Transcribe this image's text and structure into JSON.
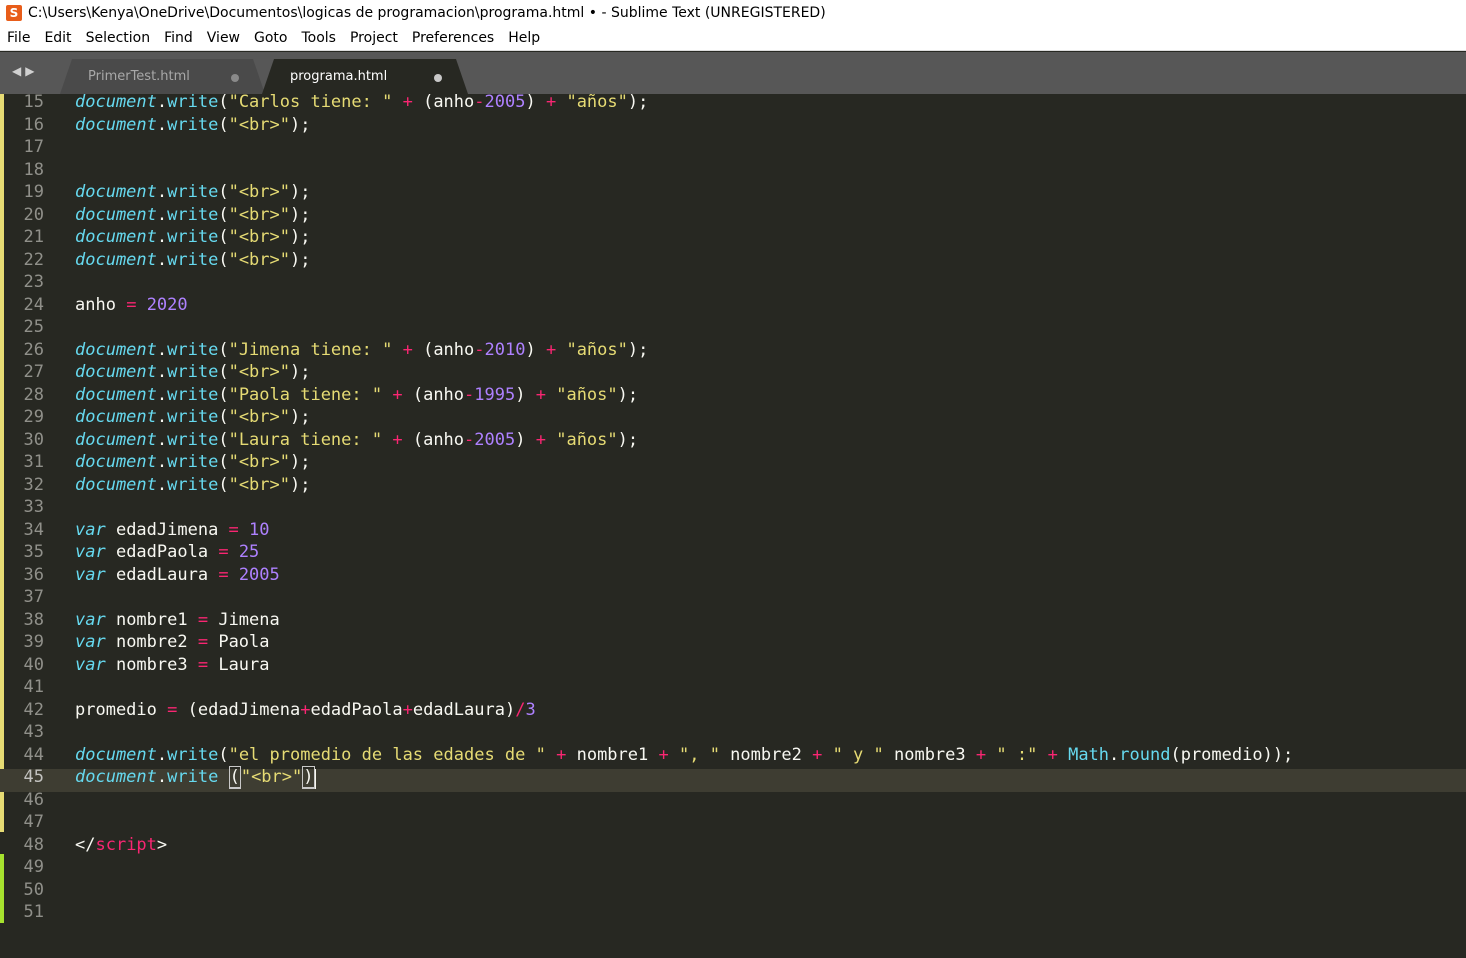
{
  "window": {
    "title": "C:\\Users\\Kenya\\OneDrive\\Documentos\\logicas de programacion\\programa.html • - Sublime Text (UNREGISTERED)",
    "app_icon": "sublime-icon"
  },
  "menu": [
    "File",
    "Edit",
    "Selection",
    "Find",
    "View",
    "Goto",
    "Tools",
    "Project",
    "Preferences",
    "Help"
  ],
  "tabs": [
    {
      "label": "PrimerTest.html",
      "active": false,
      "modified": true
    },
    {
      "label": "programa.html",
      "active": true,
      "modified": true
    }
  ],
  "editor": {
    "current_line": 45,
    "lines": [
      {
        "n": "15",
        "t": [
          [
            "k",
            "document"
          ],
          [
            "",
            "."
          ],
          [
            "f",
            "write"
          ],
          [
            "",
            "("
          ],
          [
            "s",
            "\"Carlos tiene: \""
          ],
          [
            "",
            " "
          ],
          [
            "o",
            "+"
          ],
          [
            "",
            " (anho"
          ],
          [
            "o",
            "-"
          ],
          [
            "n",
            "2005"
          ],
          [
            "",
            ") "
          ],
          [
            "o",
            "+"
          ],
          [
            "",
            " "
          ],
          [
            "s",
            "\"años\""
          ],
          [
            "",
            ");"
          ]
        ]
      },
      {
        "n": "16",
        "t": [
          [
            "k",
            "document"
          ],
          [
            "",
            "."
          ],
          [
            "f",
            "write"
          ],
          [
            "",
            "("
          ],
          [
            "s",
            "\"<br>\""
          ],
          [
            "",
            ");"
          ]
        ]
      },
      {
        "n": "17",
        "t": []
      },
      {
        "n": "18",
        "t": []
      },
      {
        "n": "19",
        "t": [
          [
            "k",
            "document"
          ],
          [
            "",
            "."
          ],
          [
            "f",
            "write"
          ],
          [
            "",
            "("
          ],
          [
            "s",
            "\"<br>\""
          ],
          [
            "",
            ");"
          ]
        ]
      },
      {
        "n": "20",
        "t": [
          [
            "k",
            "document"
          ],
          [
            "",
            "."
          ],
          [
            "f",
            "write"
          ],
          [
            "",
            "("
          ],
          [
            "s",
            "\"<br>\""
          ],
          [
            "",
            ");"
          ]
        ]
      },
      {
        "n": "21",
        "t": [
          [
            "k",
            "document"
          ],
          [
            "",
            "."
          ],
          [
            "f",
            "write"
          ],
          [
            "",
            "("
          ],
          [
            "s",
            "\"<br>\""
          ],
          [
            "",
            ");"
          ]
        ]
      },
      {
        "n": "22",
        "t": [
          [
            "k",
            "document"
          ],
          [
            "",
            "."
          ],
          [
            "f",
            "write"
          ],
          [
            "",
            "("
          ],
          [
            "s",
            "\"<br>\""
          ],
          [
            "",
            ");"
          ]
        ]
      },
      {
        "n": "23",
        "t": []
      },
      {
        "n": "24",
        "t": [
          [
            "",
            "anho "
          ],
          [
            "o",
            "="
          ],
          [
            "",
            " "
          ],
          [
            "n",
            "2020"
          ]
        ]
      },
      {
        "n": "25",
        "t": []
      },
      {
        "n": "26",
        "t": [
          [
            "k",
            "document"
          ],
          [
            "",
            "."
          ],
          [
            "f",
            "write"
          ],
          [
            "",
            "("
          ],
          [
            "s",
            "\"Jimena tiene: \""
          ],
          [
            "",
            " "
          ],
          [
            "o",
            "+"
          ],
          [
            "",
            " (anho"
          ],
          [
            "o",
            "-"
          ],
          [
            "n",
            "2010"
          ],
          [
            "",
            ") "
          ],
          [
            "o",
            "+"
          ],
          [
            "",
            " "
          ],
          [
            "s",
            "\"años\""
          ],
          [
            "",
            ");"
          ]
        ]
      },
      {
        "n": "27",
        "t": [
          [
            "k",
            "document"
          ],
          [
            "",
            "."
          ],
          [
            "f",
            "write"
          ],
          [
            "",
            "("
          ],
          [
            "s",
            "\"<br>\""
          ],
          [
            "",
            ");"
          ]
        ]
      },
      {
        "n": "28",
        "t": [
          [
            "k",
            "document"
          ],
          [
            "",
            "."
          ],
          [
            "f",
            "write"
          ],
          [
            "",
            "("
          ],
          [
            "s",
            "\"Paola tiene: \""
          ],
          [
            "",
            " "
          ],
          [
            "o",
            "+"
          ],
          [
            "",
            " (anho"
          ],
          [
            "o",
            "-"
          ],
          [
            "n",
            "1995"
          ],
          [
            "",
            ") "
          ],
          [
            "o",
            "+"
          ],
          [
            "",
            " "
          ],
          [
            "s",
            "\"años\""
          ],
          [
            "",
            ");"
          ]
        ]
      },
      {
        "n": "29",
        "t": [
          [
            "k",
            "document"
          ],
          [
            "",
            "."
          ],
          [
            "f",
            "write"
          ],
          [
            "",
            "("
          ],
          [
            "s",
            "\"<br>\""
          ],
          [
            "",
            ");"
          ]
        ]
      },
      {
        "n": "30",
        "t": [
          [
            "k",
            "document"
          ],
          [
            "",
            "."
          ],
          [
            "f",
            "write"
          ],
          [
            "",
            "("
          ],
          [
            "s",
            "\"Laura tiene: \""
          ],
          [
            "",
            " "
          ],
          [
            "o",
            "+"
          ],
          [
            "",
            " (anho"
          ],
          [
            "o",
            "-"
          ],
          [
            "n",
            "2005"
          ],
          [
            "",
            ") "
          ],
          [
            "o",
            "+"
          ],
          [
            "",
            " "
          ],
          [
            "s",
            "\"años\""
          ],
          [
            "",
            ");"
          ]
        ]
      },
      {
        "n": "31",
        "t": [
          [
            "k",
            "document"
          ],
          [
            "",
            "."
          ],
          [
            "f",
            "write"
          ],
          [
            "",
            "("
          ],
          [
            "s",
            "\"<br>\""
          ],
          [
            "",
            ");"
          ]
        ]
      },
      {
        "n": "32",
        "t": [
          [
            "k",
            "document"
          ],
          [
            "",
            "."
          ],
          [
            "f",
            "write"
          ],
          [
            "",
            "("
          ],
          [
            "s",
            "\"<br>\""
          ],
          [
            "",
            ");"
          ]
        ]
      },
      {
        "n": "33",
        "t": []
      },
      {
        "n": "34",
        "t": [
          [
            "k",
            "var"
          ],
          [
            "",
            " edadJimena "
          ],
          [
            "o",
            "="
          ],
          [
            "",
            " "
          ],
          [
            "n",
            "10"
          ]
        ]
      },
      {
        "n": "35",
        "t": [
          [
            "k",
            "var"
          ],
          [
            "",
            " edadPaola "
          ],
          [
            "o",
            "="
          ],
          [
            "",
            " "
          ],
          [
            "n",
            "25"
          ]
        ]
      },
      {
        "n": "36",
        "t": [
          [
            "k",
            "var"
          ],
          [
            "",
            " edadLaura "
          ],
          [
            "o",
            "="
          ],
          [
            "",
            " "
          ],
          [
            "n",
            "2005"
          ]
        ]
      },
      {
        "n": "37",
        "t": []
      },
      {
        "n": "38",
        "t": [
          [
            "k",
            "var"
          ],
          [
            "",
            " nombre1 "
          ],
          [
            "o",
            "="
          ],
          [
            "",
            " Jimena"
          ]
        ]
      },
      {
        "n": "39",
        "t": [
          [
            "k",
            "var"
          ],
          [
            "",
            " nombre2 "
          ],
          [
            "o",
            "="
          ],
          [
            "",
            " Paola"
          ]
        ]
      },
      {
        "n": "40",
        "t": [
          [
            "k",
            "var"
          ],
          [
            "",
            " nombre3 "
          ],
          [
            "o",
            "="
          ],
          [
            "",
            " Laura"
          ]
        ]
      },
      {
        "n": "41",
        "t": []
      },
      {
        "n": "42",
        "t": [
          [
            "",
            "promedio "
          ],
          [
            "o",
            "="
          ],
          [
            "",
            " (edadJimena"
          ],
          [
            "o",
            "+"
          ],
          [
            "",
            "edadPaola"
          ],
          [
            "o",
            "+"
          ],
          [
            "",
            "edadLaura)"
          ],
          [
            "o",
            "/"
          ],
          [
            "n",
            "3"
          ]
        ]
      },
      {
        "n": "43",
        "t": []
      },
      {
        "n": "44",
        "t": [
          [
            "k",
            "document"
          ],
          [
            "",
            "."
          ],
          [
            "f",
            "write"
          ],
          [
            "",
            "("
          ],
          [
            "s",
            "\"el promedio de las edades de \""
          ],
          [
            "",
            " "
          ],
          [
            "o",
            "+"
          ],
          [
            "",
            " nombre1 "
          ],
          [
            "o",
            "+"
          ],
          [
            "",
            " "
          ],
          [
            "s",
            "\", \""
          ],
          [
            "",
            " nombre2 "
          ],
          [
            "o",
            "+"
          ],
          [
            "",
            " "
          ],
          [
            "s",
            "\" y \""
          ],
          [
            "",
            " nombre3 "
          ],
          [
            "o",
            "+"
          ],
          [
            "",
            " "
          ],
          [
            "s",
            "\" :\""
          ],
          [
            "",
            " "
          ],
          [
            "o",
            "+"
          ],
          [
            "",
            " "
          ],
          [
            "f",
            "Math"
          ],
          [
            "",
            "."
          ],
          [
            "f",
            "round"
          ],
          [
            "",
            "(promedio));"
          ]
        ]
      },
      {
        "n": "45",
        "t": [
          [
            "k",
            "document"
          ],
          [
            "",
            "."
          ],
          [
            "f",
            "write"
          ],
          [
            "",
            " "
          ],
          [
            "cb",
            "("
          ],
          [
            "s",
            "\"<br>\""
          ],
          [
            "cb",
            ")"
          ],
          [
            "caret",
            ""
          ]
        ]
      },
      {
        "n": "46",
        "t": []
      },
      {
        "n": "47",
        "t": []
      },
      {
        "n": "48",
        "t": [
          [
            "",
            "</"
          ],
          [
            "t",
            "script"
          ],
          [
            "",
            ">"
          ]
        ]
      },
      {
        "n": "49",
        "t": []
      },
      {
        "n": "50",
        "t": []
      },
      {
        "n": "51",
        "t": []
      }
    ]
  },
  "colors": {
    "background": "#272822",
    "keyword": "#66d9ef",
    "string": "#e6db74",
    "operator": "#f92672",
    "number": "#ae81ff",
    "modified_marker": "#e6db74",
    "added_marker": "#a6e22e"
  }
}
